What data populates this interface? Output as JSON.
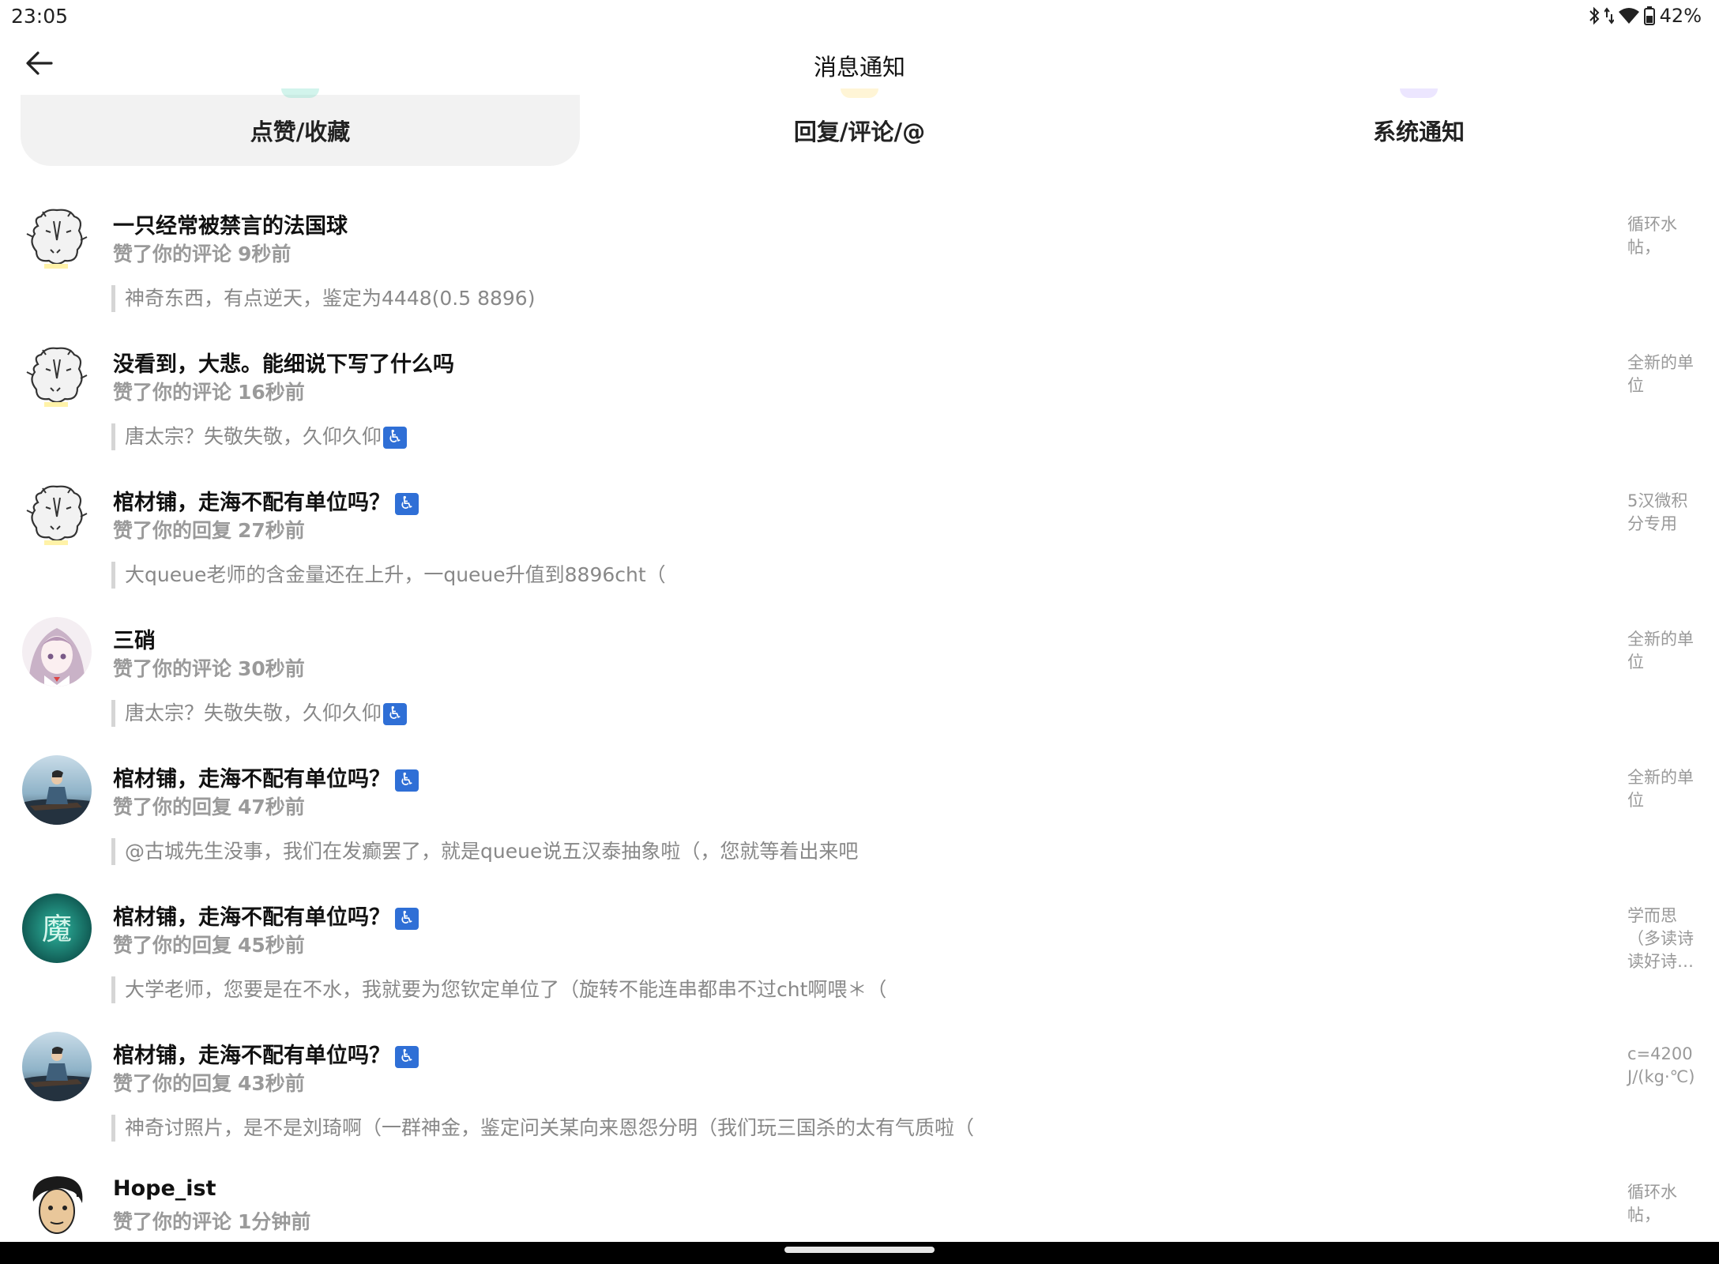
{
  "status_bar": {
    "time": "23:05",
    "battery": "42%",
    "icons": [
      "bluetooth-icon",
      "data-icon",
      "wifi-icon",
      "battery-icon"
    ]
  },
  "header": {
    "title": "消息通知",
    "back_icon": "arrow-left-icon"
  },
  "tabs": [
    {
      "label": "点赞/收藏",
      "active": true,
      "accent": "#7fe0c8"
    },
    {
      "label": "回复/评论/@",
      "active": false,
      "accent": "#ffe38a"
    },
    {
      "label": "系统通知",
      "active": false,
      "accent": "#c8b6ff"
    }
  ],
  "notifications": [
    {
      "avatar": "sketch",
      "title": "一只经常被禁言的法国球",
      "title_icon": false,
      "action": "赞了你的评论",
      "time": "9秒前",
      "quote": "神奇东西，有点逆天，鉴定为4448(0.5 8896)",
      "quote_icon": false,
      "right": "循环水帖，"
    },
    {
      "avatar": "sketch",
      "title": "没看到，大悲。能细说下写了什么吗",
      "title_icon": false,
      "action": "赞了你的评论",
      "time": "16秒前",
      "quote": "唐太宗？失敬失敬，久仰久仰",
      "quote_icon": true,
      "right": "全新的单位"
    },
    {
      "avatar": "sketch",
      "title": "棺材铺，走海不配有单位吗？",
      "title_icon": true,
      "action": "赞了你的回复",
      "time": "27秒前",
      "quote": "大queue老师的含金量还在上升，一queue升值到8896cht（",
      "quote_icon": false,
      "right": "5汉微积分专用"
    },
    {
      "avatar": "anime",
      "title": "三硝",
      "title_icon": false,
      "action": "赞了你的评论",
      "time": "30秒前",
      "quote": "唐太宗？失敬失敬，久仰久仰",
      "quote_icon": true,
      "right": "全新的单位"
    },
    {
      "avatar": "scene",
      "title": "棺材铺，走海不配有单位吗？",
      "title_icon": true,
      "action": "赞了你的回复",
      "time": "47秒前",
      "quote": "@古城先生没事，我们在发癫罢了，就是queue说五汉泰抽象啦（，您就等着出来吧",
      "quote_icon": false,
      "right": "全新的单位"
    },
    {
      "avatar": "teal",
      "avatar_char": "魔",
      "title": "棺材铺，走海不配有单位吗？",
      "title_icon": true,
      "action": "赞了你的回复",
      "time": "45秒前",
      "quote": "大学老师，您要是在不水，我就要为您钦定单位了（旋转不能连串都串不过cht啊喂＊（",
      "quote_icon": false,
      "right": "学而思（多读诗读好诗…"
    },
    {
      "avatar": "scene",
      "title": "棺材铺，走海不配有单位吗？",
      "title_icon": true,
      "action": "赞了你的回复",
      "time": "43秒前",
      "quote": "神奇讨照片，是不是刘琦啊（一群神金，鉴定问关某向来恩怨分明（我们玩三国杀的太有气质啦（",
      "quote_icon": false,
      "right": "c=4200 J/(kg·℃)"
    },
    {
      "avatar": "face",
      "title": "Hope_ist",
      "title_icon": false,
      "action": "赞了你的评论",
      "time": "1分钟前",
      "quote": "",
      "quote_icon": false,
      "right": "循环水帖，"
    }
  ],
  "wheelchair_symbol": "♿"
}
